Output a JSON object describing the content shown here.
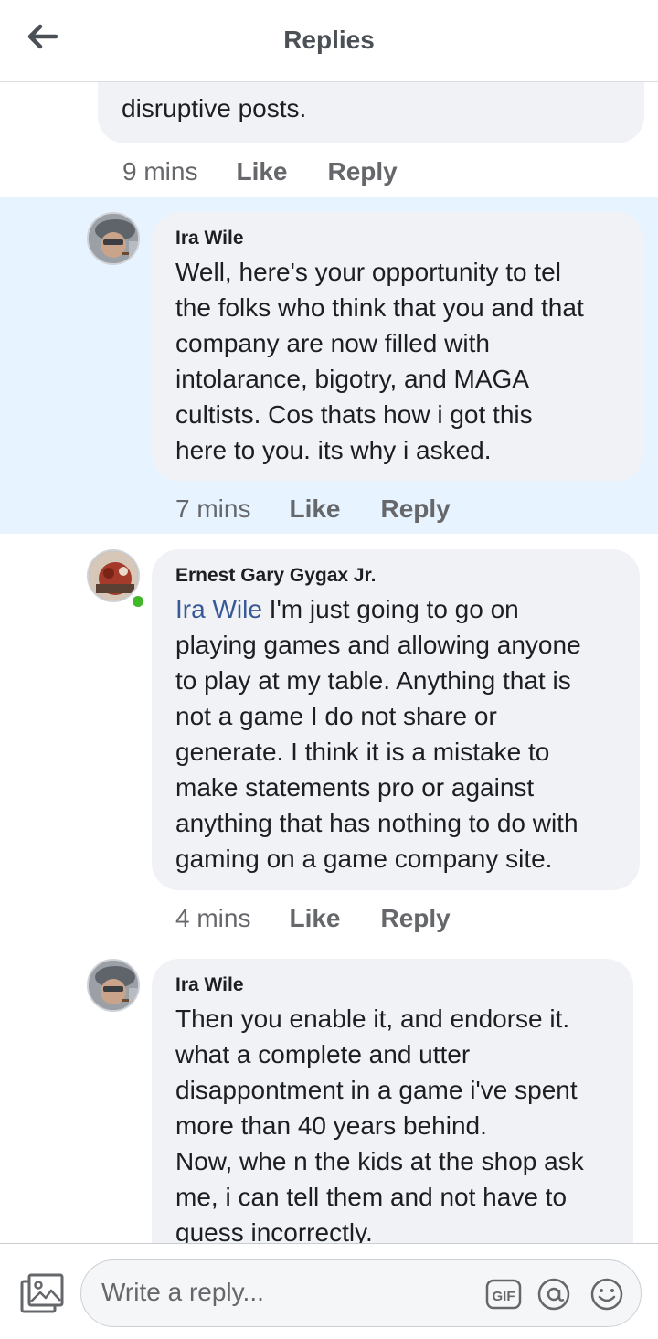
{
  "header": {
    "title": "Replies",
    "back_icon": "arrow-left-icon"
  },
  "colors": {
    "highlight": "#e7f3ff",
    "bubble": "#f0f2f5",
    "mention": "#385898",
    "online": "#42b72a"
  },
  "prev_reply": {
    "text": "disruptive posts.",
    "time": "9 mins",
    "like": "Like",
    "reply": "Reply"
  },
  "comments": [
    {
      "author": "Ira Wile",
      "text": "Well, here's your opportunity to tel\nthe folks who think that you and that\ncompany are now filled with\nintolarance, bigotry,  and MAGA\ncultists.  Cos thats how i got this\nhere to you.   its why i asked.",
      "time": "7 mins",
      "like": "Like",
      "reply": "Reply"
    },
    {
      "author": "Ernest Gary Gygax Jr.",
      "mention": "Ira Wile",
      "text": " I'm just going to go on\nplaying games and allowing anyone\nto play at my table. Anything that is\nnot a game I do not share or\ngenerate. I think it is a mistake to\nmake statements pro or against\nanything that has nothing to do with\ngaming on a game company site.",
      "time": "4 mins",
      "like": "Like",
      "reply": "Reply"
    },
    {
      "author": "Ira Wile",
      "text": "Then you enable it, and endorse it.\nwhat a complete and utter\ndisappontment in a game i've spent\nmore than 40 years behind.\nNow, whe n the kids at the shop ask\nme, i can tell them and not have to\nguess incorrectly."
    }
  ],
  "composer": {
    "placeholder": "Write a reply...",
    "photo_icon": "photo-icon",
    "gif_label": "GIF",
    "at_icon": "at-icon",
    "emoji_icon": "emoji-icon"
  }
}
